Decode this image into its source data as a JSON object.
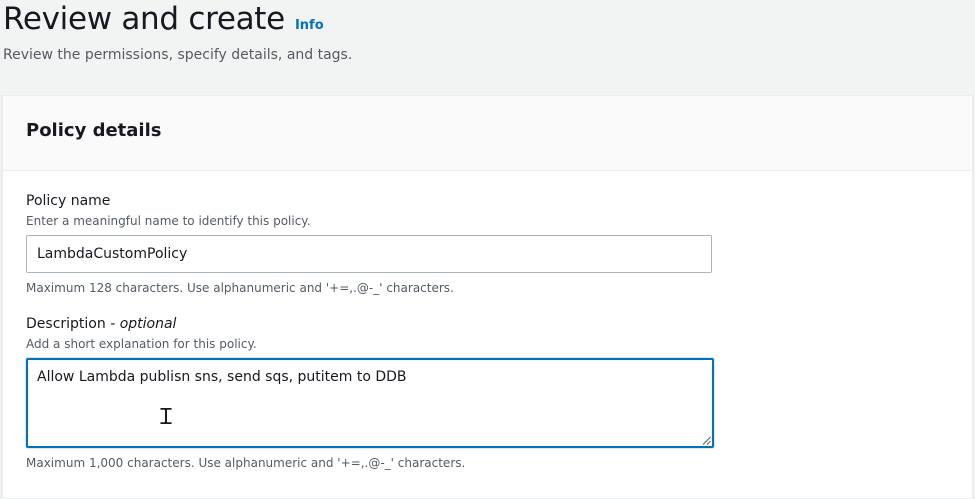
{
  "header": {
    "title": "Review and create",
    "info": "Info",
    "subtitle": "Review the permissions, specify details, and tags."
  },
  "panel": {
    "title": "Policy details",
    "policy_name": {
      "label": "Policy name",
      "description": "Enter a meaningful name to identify this policy.",
      "value": "LambdaCustomPolicy",
      "constraint": "Maximum 128 characters. Use alphanumeric and '+=,.@-_' characters."
    },
    "description_field": {
      "label": "Description",
      "label_suffix": "- optional",
      "description": "Add a short explanation for this policy.",
      "value": "Allow Lambda publisn sns, send sqs, putitem to DDB",
      "constraint": "Maximum 1,000 characters. Use alphanumeric and '+=,.@-_' characters."
    }
  },
  "icons": {
    "text_cursor": "i-beam-cursor-icon",
    "resize": "resize-handle-icon"
  },
  "colors": {
    "link": "#0073bb",
    "focus_border": "#0073bb",
    "page_bg": "#f2f3f3"
  }
}
